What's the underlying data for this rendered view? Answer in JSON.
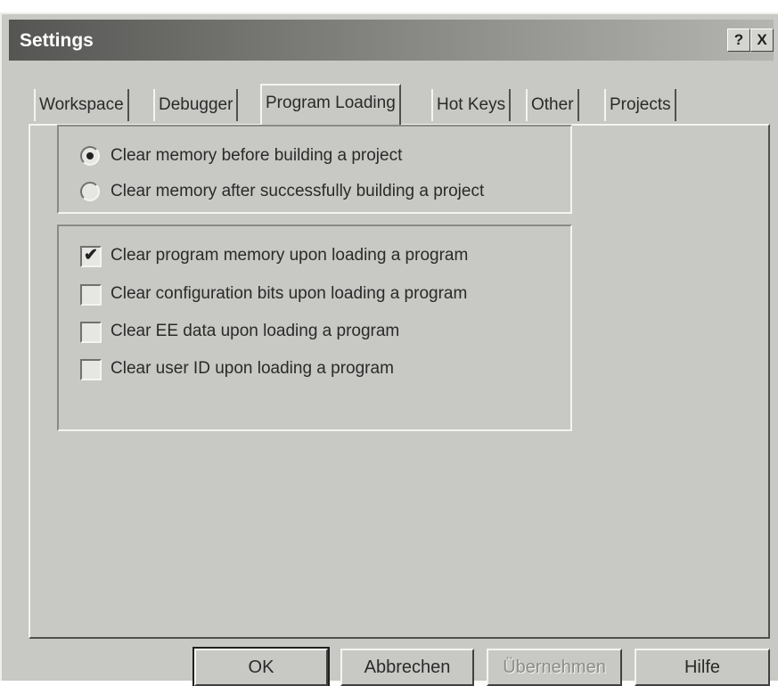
{
  "window": {
    "title": "Settings"
  },
  "title_buttons": {
    "help": "?",
    "close": "X"
  },
  "tabs": [
    {
      "label": "Workspace",
      "active": false
    },
    {
      "label": "Debugger",
      "active": false
    },
    {
      "label": "Program Loading",
      "active": true
    },
    {
      "label": "Hot Keys",
      "active": false
    },
    {
      "label": "Other",
      "active": false
    },
    {
      "label": "Projects",
      "active": false
    }
  ],
  "memory_options": [
    {
      "label": "Clear memory before building a project",
      "selected": true
    },
    {
      "label": "Clear memory after successfully building a project",
      "selected": false
    }
  ],
  "load_options": [
    {
      "label": "Clear program memory upon loading a program",
      "checked": true
    },
    {
      "label": "Clear configuration bits upon loading a program",
      "checked": false
    },
    {
      "label": "Clear EE data upon loading a program",
      "checked": false
    },
    {
      "label": "Clear user ID upon loading a program",
      "checked": false
    }
  ],
  "buttons": {
    "ok": "OK",
    "cancel": "Abbrechen",
    "apply": "Übernehmen",
    "help": "Hilfe"
  },
  "icons": {
    "help": "question-mark-icon",
    "close": "close-icon",
    "check": "checkmark-icon"
  },
  "colors": {
    "face": "#c8c8c4",
    "title_start": "#555553",
    "title_end": "#b4b4b0"
  }
}
